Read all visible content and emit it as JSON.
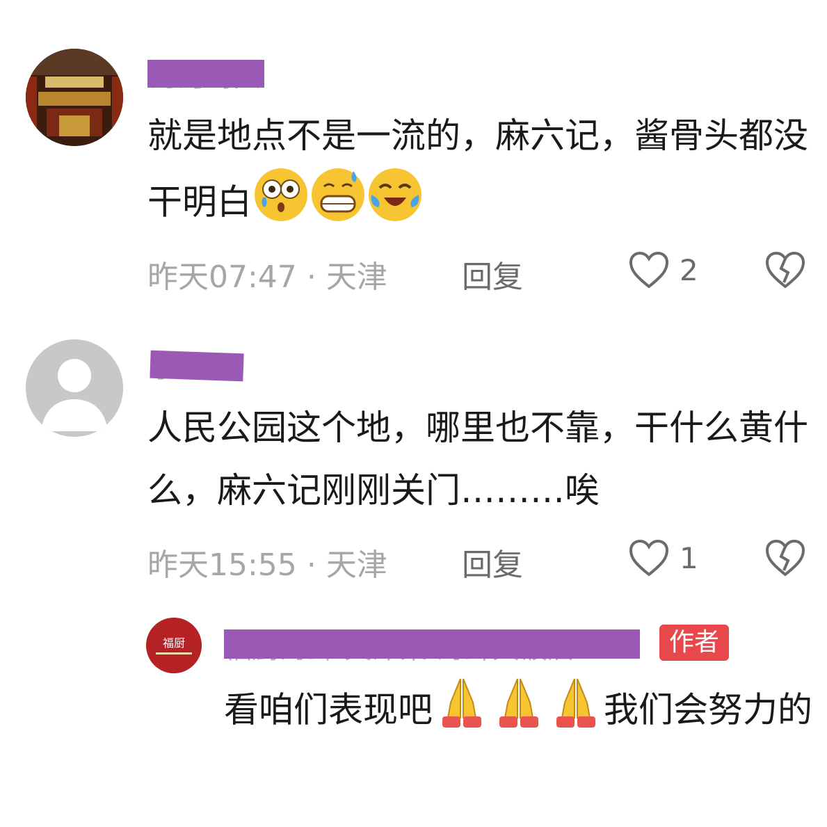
{
  "comments": [
    {
      "username": "海河码头",
      "text": "就是地点不是一流的，麻六记，酱骨头都没干明白",
      "emojis": [
        "astonished-tear-emoji",
        "grimace-sweat-emoji",
        "tears-of-joy-emoji"
      ],
      "time": "昨天07:47",
      "sep": "·",
      "location": "天津",
      "reply_label": "回复",
      "like_count": "2"
    },
    {
      "username": "小福",
      "text": "人民公园这个地，哪里也不靠，干什么黄什么，麻六记刚刚关门………唉",
      "time": "昨天15:55",
      "sep": "·",
      "location": "天津",
      "reply_label": "回复",
      "like_count": "1"
    }
  ],
  "reply": {
    "username": "福厨海鲜·天津菜·海鲜大饭店",
    "avatar_text": "福厨",
    "author_badge": "作者",
    "text_part1": "看咱们表现吧",
    "text_part2": "我们会努力的",
    "emojis": [
      "folded-hands-emoji",
      "folded-hands-emoji",
      "folded-hands-emoji"
    ]
  },
  "colors": {
    "mask": "#9b59b6",
    "author_badge": "#e8484b",
    "avatar_reply": "#b52225"
  }
}
